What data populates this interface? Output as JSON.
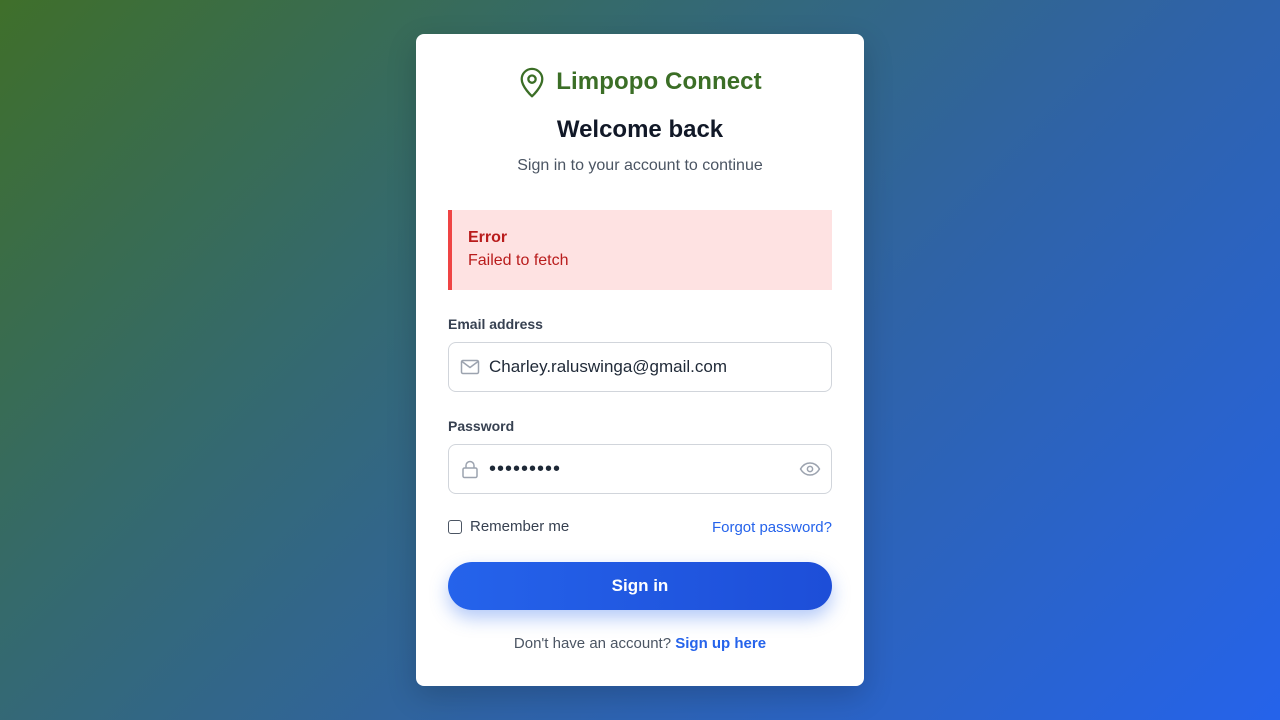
{
  "brand": {
    "name": "Limpopo Connect",
    "icon": "map-pin-icon",
    "color": "#3b6e26"
  },
  "heading": {
    "title": "Welcome back",
    "subtitle": "Sign in to your account to continue"
  },
  "alert": {
    "title": "Error",
    "message": "Failed to fetch",
    "bg_color": "#fee2e2",
    "accent_color": "#ef4444"
  },
  "form": {
    "email": {
      "label": "Email address",
      "value": "Charley.raluswinga@gmail.com",
      "icon": "mail-icon"
    },
    "password": {
      "label": "Password",
      "value": "•••••••••",
      "icon": "lock-icon",
      "toggle_icon": "eye-icon"
    },
    "remember_label": "Remember me",
    "remember_checked": false,
    "forgot_label": "Forgot password?",
    "submit_label": "Sign in"
  },
  "footer": {
    "prompt": "Don't have an account?",
    "link_label": "Sign up here"
  },
  "colors": {
    "accent": "#2563eb",
    "text_dark": "#111827"
  }
}
